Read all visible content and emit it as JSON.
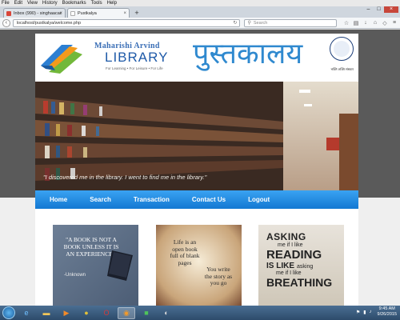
{
  "menubar": [
    "File",
    "Edit",
    "View",
    "History",
    "Bookmarks",
    "Tools",
    "Help"
  ],
  "tabs": [
    {
      "label": "Inbox (990) - singhaacadi@...",
      "active": false
    },
    {
      "label": "Pustkalya",
      "active": true
    }
  ],
  "nav": {
    "url": "localhost/pustkalya/welcome.php",
    "search_placeholder": "Search"
  },
  "header": {
    "library_name": "Maharishi Arvind",
    "library_title": "LIBRARY",
    "tagline": "For Learning • For Leisure • For Life",
    "hindi_title": "पुस्तकालय",
    "emblem_tag": "भक्ति शक्ति संस्कार"
  },
  "banner": {
    "quote": "\"I discovered me in the library. I went to find me in the library.\""
  },
  "menu": [
    "Home",
    "Search",
    "Transaction",
    "Contact Us",
    "Logout"
  ],
  "cards": {
    "card1": {
      "quote": "\"A BOOK IS NOT A BOOK UNLESS IT IS AN EXPERIENCE.\"",
      "author": "-Unknown"
    },
    "card2": {
      "left": "Life is an open book full of blank pages",
      "right": "You write the story as you go"
    },
    "card3": {
      "l1": "ASKING",
      "l2": "me if I like",
      "l3": "READING",
      "l4": "IS LIKE",
      "l5": "asking",
      "l6": "me if I like",
      "l7": "BREATHING"
    }
  },
  "taskbar": {
    "time": "9:45 AM",
    "date": "9/26/2015"
  },
  "colors": {
    "accent": "#1f7fd6",
    "header_text": "#1f5aa8",
    "hindi": "#2f89cf"
  }
}
